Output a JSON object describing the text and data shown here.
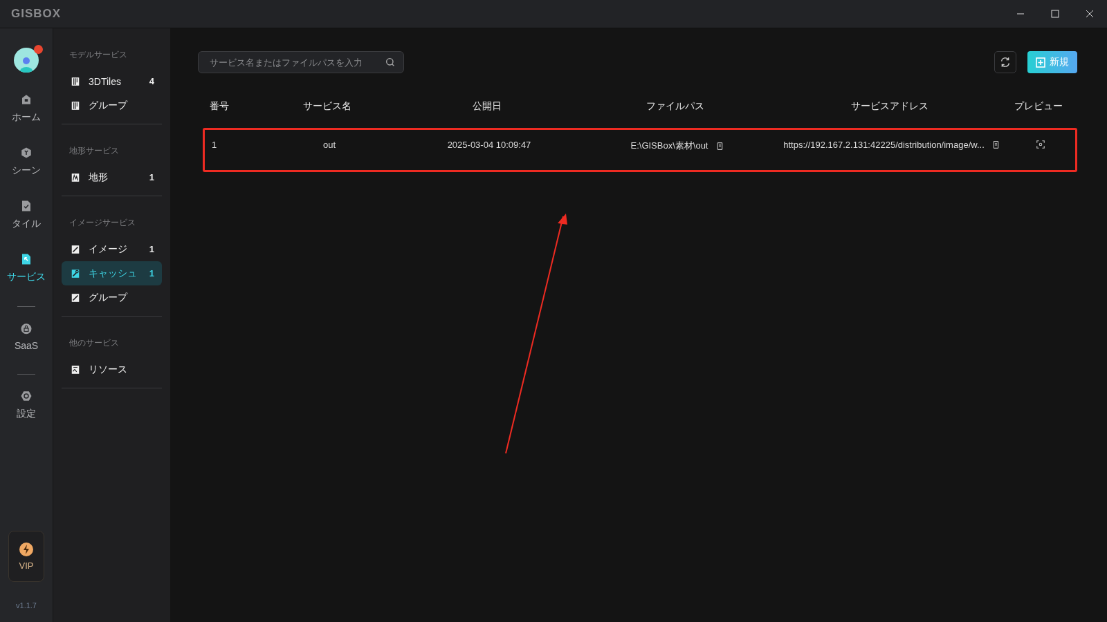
{
  "window": {
    "logo": "GISBOX"
  },
  "rail": {
    "items": [
      {
        "kind": "home",
        "label": "ホーム",
        "selected": false
      },
      {
        "kind": "scene",
        "label": "シーン",
        "selected": false
      },
      {
        "kind": "tile",
        "label": "タイル",
        "selected": false
      },
      {
        "kind": "service",
        "label": "サービス",
        "selected": true
      },
      {
        "kind": "divider"
      },
      {
        "kind": "saas",
        "label": "SaaS",
        "selected": false
      },
      {
        "kind": "divider"
      },
      {
        "kind": "settings",
        "label": "設定",
        "selected": false
      }
    ],
    "vip": "VIP",
    "version": "v1.1.7"
  },
  "sidebar": {
    "groups": [
      {
        "title": "モデルサービス",
        "items": [
          {
            "kind": "model",
            "label": "3DTiles",
            "count": "4",
            "selected": false
          },
          {
            "kind": "model",
            "label": "グループ",
            "selected": false
          }
        ]
      },
      {
        "title": "地形サービス",
        "items": [
          {
            "kind": "terrain",
            "label": "地形",
            "count": "1",
            "selected": false
          }
        ]
      },
      {
        "title": "イメージサービス",
        "items": [
          {
            "kind": "image",
            "label": "イメージ",
            "count": "1",
            "selected": false
          },
          {
            "kind": "cache",
            "label": "キャッシュ",
            "count": "1",
            "selected": true
          },
          {
            "kind": "image",
            "label": "グループ",
            "selected": false
          }
        ]
      },
      {
        "title": "他のサービス",
        "items": [
          {
            "kind": "resource",
            "label": "リソース",
            "selected": false
          }
        ]
      }
    ]
  },
  "search": {
    "placeholder": "サービス名またはファイルパスを入力"
  },
  "new_button": "新規",
  "table": {
    "columns": [
      "番号",
      "サービス名",
      "公開日",
      "ファイルパス",
      "サービスアドレス",
      "プレビュー"
    ],
    "rows": [
      {
        "number": "1",
        "name": "out",
        "date": "2025-03-04 10:09:47",
        "path": "E:\\GISBox\\素材\\out",
        "address": "https://192.167.2.131:42225/distribution/image/w...",
        "highlighted": true
      }
    ]
  }
}
